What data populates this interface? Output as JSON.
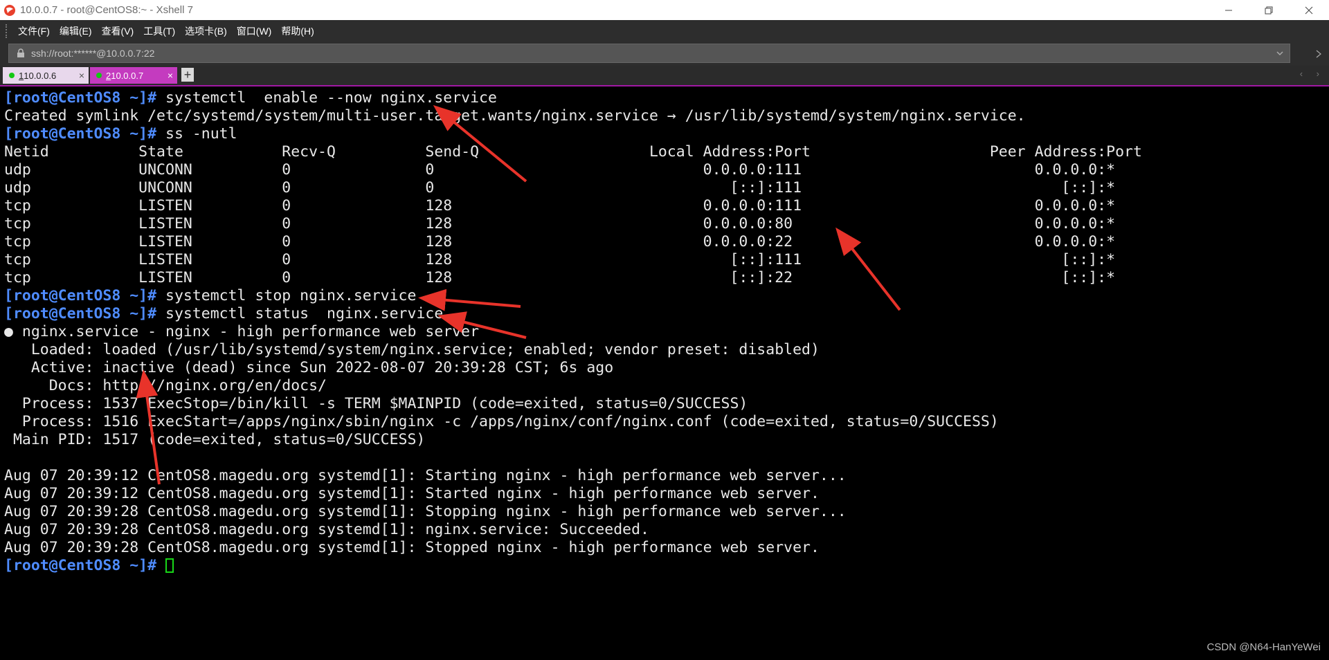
{
  "window": {
    "title": "10.0.0.7 - root@CentOS8:~ - Xshell 7",
    "brand_color": "#e8402c",
    "controls": [
      "minimize-icon",
      "restore-icon",
      "close-icon"
    ]
  },
  "menu": {
    "items": [
      "文件(F)",
      "编辑(E)",
      "查看(V)",
      "工具(T)",
      "选项卡(B)",
      "窗口(W)",
      "帮助(H)"
    ]
  },
  "address": {
    "value": "ssh://root:******@10.0.0.7:22"
  },
  "tabs": [
    {
      "num": "1",
      "label": " 10.0.0.6",
      "close": "×",
      "active": false
    },
    {
      "num": "2",
      "label": " 10.0.0.7",
      "close": "×",
      "active": true
    }
  ],
  "new_tab": "+",
  "tab_nav": "‹ ›",
  "terminal": {
    "prompt": "[root@CentOS8 ~]#",
    "lines": [
      {
        "type": "cmd",
        "text": " systemctl  enable --now nginx.service"
      },
      {
        "type": "out",
        "text": "Created symlink /etc/systemd/system/multi-user.target.wants/nginx.service → /usr/lib/systemd/system/nginx.service."
      },
      {
        "type": "cmd",
        "text": " ss -nutl"
      },
      {
        "type": "out",
        "text": "Netid          State           Recv-Q          Send-Q                   Local Address:Port                    Peer Address:Port"
      },
      {
        "type": "out",
        "text": "udp            UNCONN          0               0                              0.0.0.0:111                          0.0.0.0:*"
      },
      {
        "type": "out",
        "text": "udp            UNCONN          0               0                                 [::]:111                             [::]:*"
      },
      {
        "type": "out",
        "text": "tcp            LISTEN          0               128                            0.0.0.0:111                          0.0.0.0:*"
      },
      {
        "type": "out",
        "text": "tcp            LISTEN          0               128                            0.0.0.0:80                           0.0.0.0:*"
      },
      {
        "type": "out",
        "text": "tcp            LISTEN          0               128                            0.0.0.0:22                           0.0.0.0:*"
      },
      {
        "type": "out",
        "text": "tcp            LISTEN          0               128                               [::]:111                             [::]:*"
      },
      {
        "type": "out",
        "text": "tcp            LISTEN          0               128                               [::]:22                              [::]:*"
      },
      {
        "type": "cmd",
        "text": " systemctl stop nginx.service"
      },
      {
        "type": "cmd",
        "text": " systemctl status  nginx.service"
      },
      {
        "type": "out",
        "text": "● nginx.service - nginx - high performance web server"
      },
      {
        "type": "out",
        "text": "   Loaded: loaded (/usr/lib/systemd/system/nginx.service; enabled; vendor preset: disabled)"
      },
      {
        "type": "out",
        "text": "   Active: inactive (dead) since Sun 2022-08-07 20:39:28 CST; 6s ago"
      },
      {
        "type": "out",
        "text": "     Docs: http://nginx.org/en/docs/"
      },
      {
        "type": "out",
        "text": "  Process: 1537 ExecStop=/bin/kill -s TERM $MAINPID (code=exited, status=0/SUCCESS)"
      },
      {
        "type": "out",
        "text": "  Process: 1516 ExecStart=/apps/nginx/sbin/nginx -c /apps/nginx/conf/nginx.conf (code=exited, status=0/SUCCESS)"
      },
      {
        "type": "out",
        "text": " Main PID: 1517 (code=exited, status=0/SUCCESS)"
      },
      {
        "type": "out",
        "text": ""
      },
      {
        "type": "out",
        "text": "Aug 07 20:39:12 CentOS8.magedu.org systemd[1]: Starting nginx - high performance web server..."
      },
      {
        "type": "out",
        "text": "Aug 07 20:39:12 CentOS8.magedu.org systemd[1]: Started nginx - high performance web server."
      },
      {
        "type": "out",
        "text": "Aug 07 20:39:28 CentOS8.magedu.org systemd[1]: Stopping nginx - high performance web server..."
      },
      {
        "type": "out",
        "text": "Aug 07 20:39:28 CentOS8.magedu.org systemd[1]: nginx.service: Succeeded."
      },
      {
        "type": "out",
        "text": "Aug 07 20:39:28 CentOS8.magedu.org systemd[1]: Stopped nginx - high performance web server."
      },
      {
        "type": "cursor",
        "text": " "
      }
    ],
    "prompt_color": "#4f8cff",
    "text_color": "#e8e8e8",
    "cursor_color": "#18d818"
  },
  "annotation_arrow_color": "#e8332a",
  "watermark": "CSDN @N64-HanYeWei"
}
